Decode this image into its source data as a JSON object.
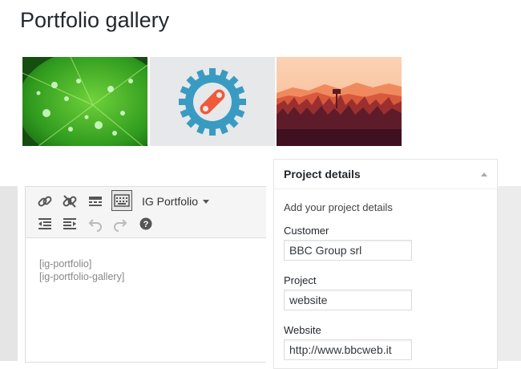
{
  "page": {
    "title": "Portfolio gallery"
  },
  "gallery": {
    "images": [
      {
        "name": "leaf-water-drops"
      },
      {
        "name": "bicycle-chain-gear-logo"
      },
      {
        "name": "sunset-forest-lookout"
      }
    ]
  },
  "editor": {
    "toolbar": {
      "buttons": [
        "link-icon",
        "unlink-icon",
        "read-more-icon",
        "toolbar-toggle-icon",
        "outdent-icon",
        "indent-icon",
        "undo-icon",
        "redo-icon",
        "help-icon"
      ],
      "dropdown_label": "IG Portfolio"
    },
    "content_lines": [
      "[ig-portfolio]",
      "[ig-portfolio-gallery]"
    ]
  },
  "metabox": {
    "title": "Project details",
    "intro": "Add your project details",
    "fields": [
      {
        "label": "Customer",
        "value": "BBC Group srl"
      },
      {
        "label": "Project",
        "value": "website"
      },
      {
        "label": "Website",
        "value": "http://www.bbcweb.it"
      }
    ]
  },
  "colors": {
    "accent": "#3a9bc2",
    "logo_orange": "#ef5a3a"
  }
}
